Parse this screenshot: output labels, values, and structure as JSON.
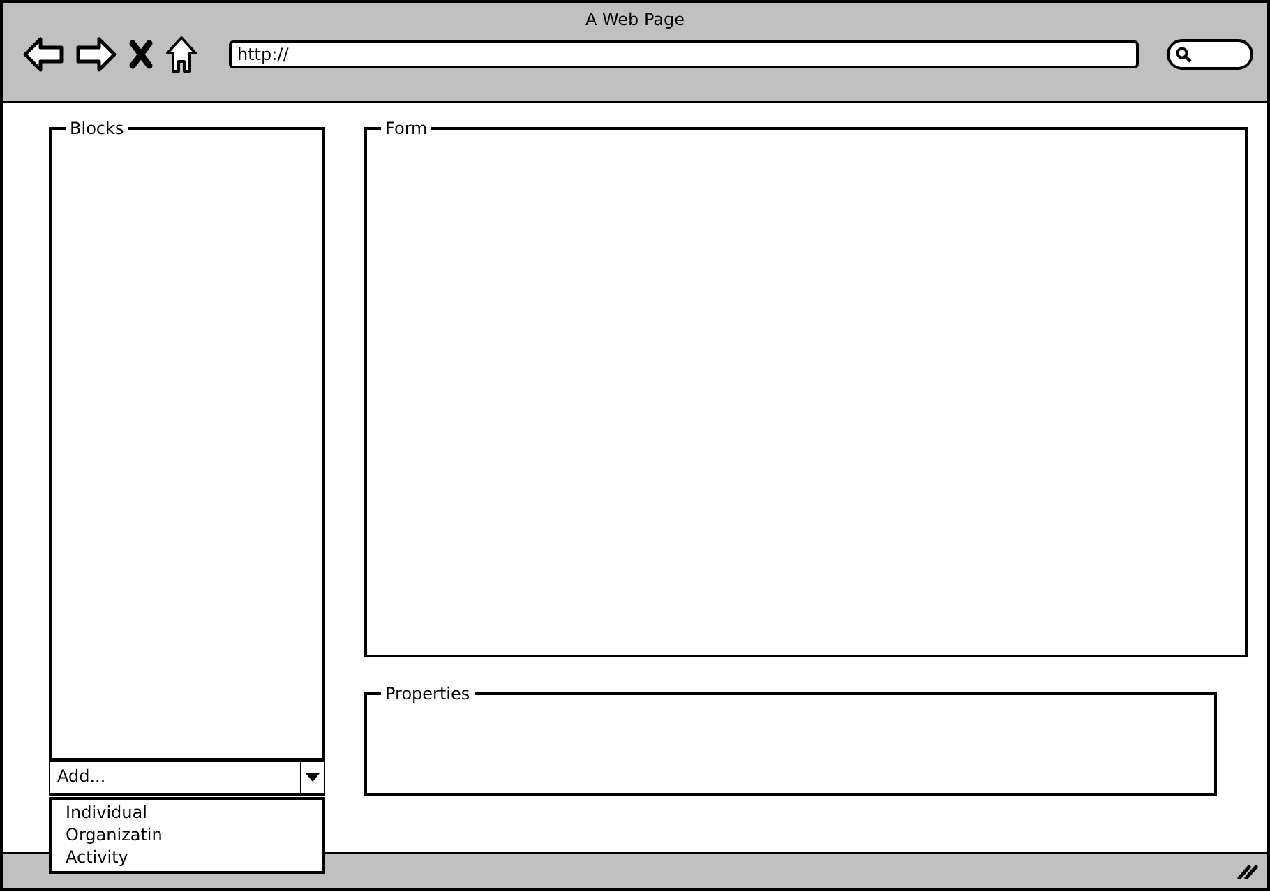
{
  "window": {
    "title": "A Web Page"
  },
  "address_bar": {
    "value": "http://"
  },
  "blocks_panel": {
    "title": "Blocks"
  },
  "add_dropdown": {
    "value": "Add...",
    "expanded": true,
    "options": [
      "Individual",
      "Organizatin",
      "Activity"
    ]
  },
  "form_panel": {
    "title": "Form"
  },
  "properties_panel": {
    "title": "Properties"
  }
}
